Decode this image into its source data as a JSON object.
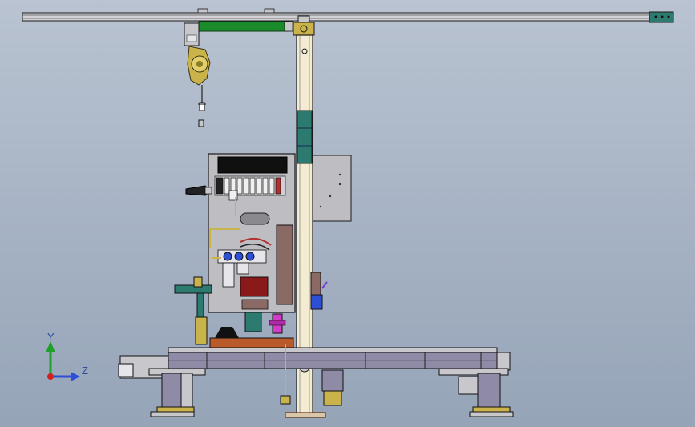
{
  "triad": {
    "x_label": "Y",
    "y_label": "Z",
    "y_axis_color": "#1fa02a",
    "z_axis_color": "#2d4fd6",
    "x_axis_color": "#d02020"
  },
  "colors": {
    "steel": "#c8c8cc",
    "outline": "#1a1a1a",
    "beam_green": "#1b8a2a",
    "teal": "#2d7a70",
    "post_cream": "#f3ecd2",
    "conveyor_purple": "#8f8aa6",
    "panel_gray": "#bdbdc2",
    "brass": "#c9b34a",
    "red_block": "#8a1a1a",
    "brown_block": "#8b6a66",
    "magenta": "#d23cc8",
    "orange_plate": "#b85a2a"
  }
}
